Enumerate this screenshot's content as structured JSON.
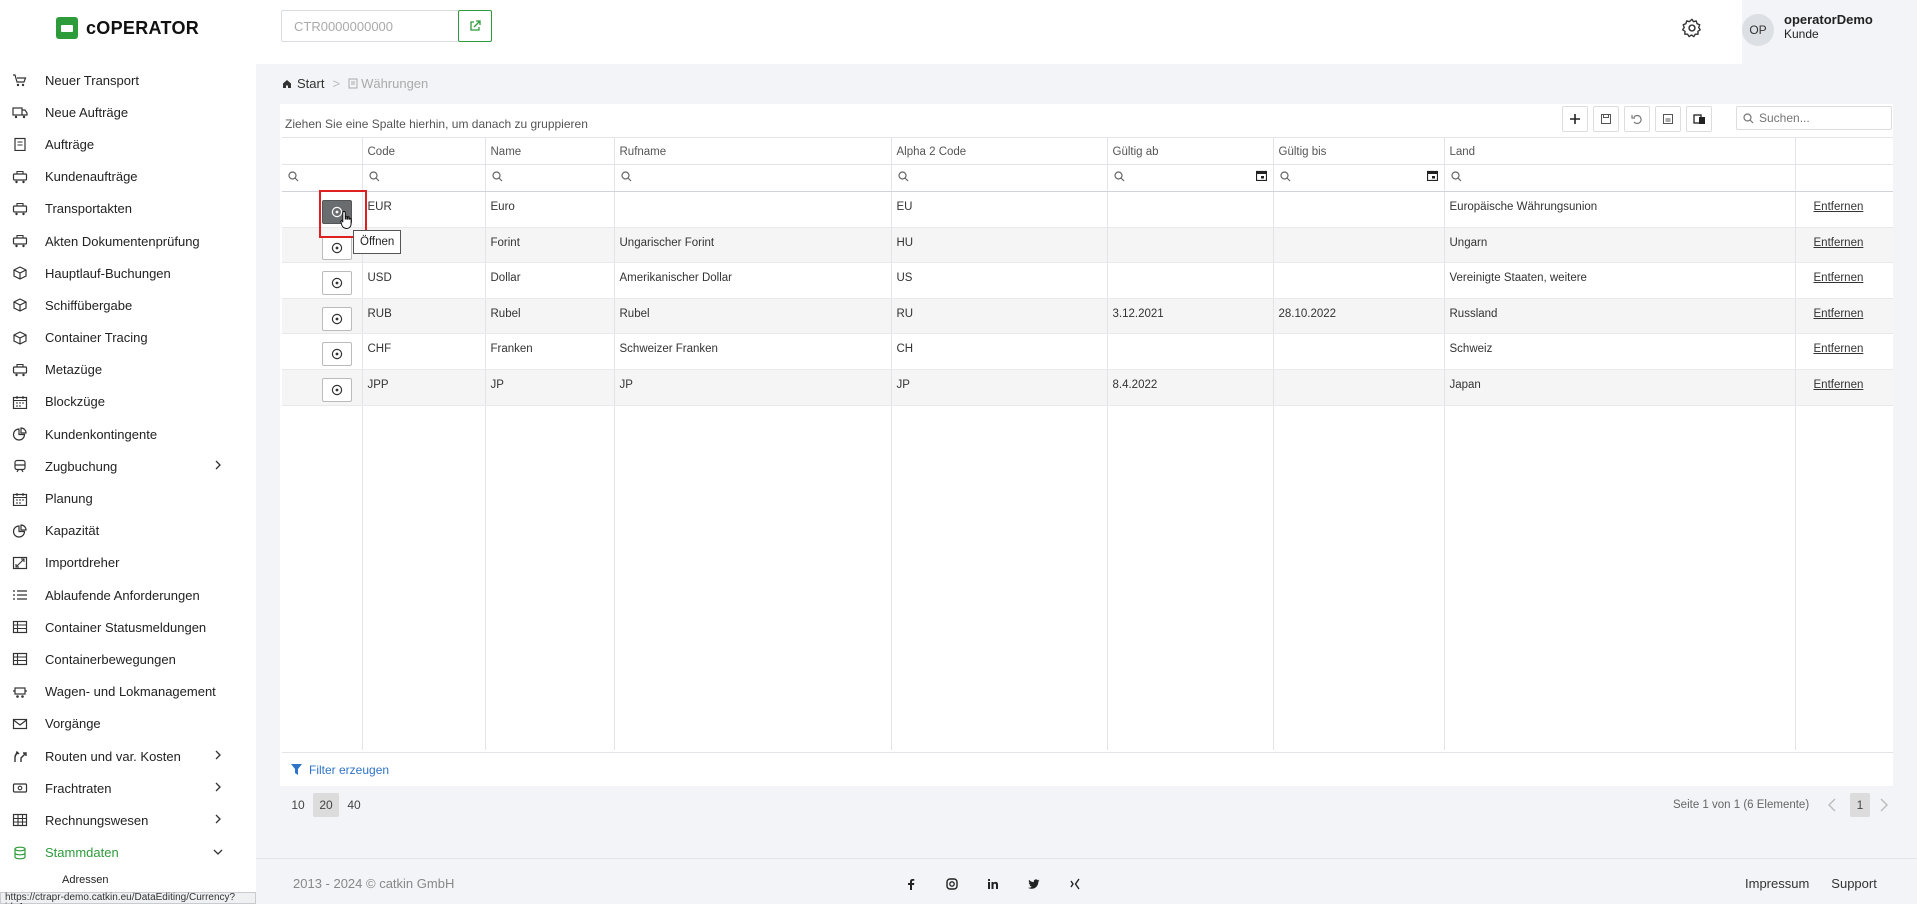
{
  "app": {
    "name": "cOPERATOR"
  },
  "sidebar": {
    "items": [
      {
        "label": "Neuer Transport",
        "icon": "truck-cart-icon"
      },
      {
        "label": "Neue Aufträge",
        "icon": "truck-plus-icon"
      },
      {
        "label": "Aufträge",
        "icon": "clipboard-icon"
      },
      {
        "label": "Kundenaufträge",
        "icon": "train-icon"
      },
      {
        "label": "Transportakten",
        "icon": "train-icon"
      },
      {
        "label": "Akten Dokumentenprüfung",
        "icon": "train-icon"
      },
      {
        "label": "Hauptlauf-Buchungen",
        "icon": "cube-icon"
      },
      {
        "label": "Schiffübergabe",
        "icon": "cube-icon"
      },
      {
        "label": "Container Tracing",
        "icon": "cube-icon"
      },
      {
        "label": "Metazüge",
        "icon": "train-icon"
      },
      {
        "label": "Blockzüge",
        "icon": "calendar-icon"
      },
      {
        "label": "Kundenkontingente",
        "icon": "pie-chart-icon"
      },
      {
        "label": "Zugbuchung",
        "icon": "train-front-icon",
        "expandable": true
      },
      {
        "label": "Planung",
        "icon": "calendar-icon"
      },
      {
        "label": "Kapazität",
        "icon": "pie-chart-icon"
      },
      {
        "label": "Importdreher",
        "icon": "swap-icon"
      },
      {
        "label": "Ablaufende Anforderungen",
        "icon": "list-icon"
      },
      {
        "label": "Container Statusmeldungen",
        "icon": "table-icon"
      },
      {
        "label": "Containerbewegungen",
        "icon": "table-icon"
      },
      {
        "label": "Wagen- und Lokmanagement",
        "icon": "wagon-icon"
      },
      {
        "label": "Vorgänge",
        "icon": "mail-icon"
      },
      {
        "label": "Routen und var. Kosten",
        "icon": "route-icon",
        "expandable": true
      },
      {
        "label": "Frachtraten",
        "icon": "money-icon",
        "expandable": true
      },
      {
        "label": "Rechnungswesen",
        "icon": "grid-icon",
        "expandable": true
      },
      {
        "label": "Stammdaten",
        "icon": "database-icon",
        "expandable": true,
        "active": true
      }
    ],
    "sub_items": [
      {
        "label": "Adressen"
      }
    ],
    "status_url": "https://ctrapr-demo.catkin.eu/DataEditing/Currency?id=1"
  },
  "topbar": {
    "ctr_placeholder": "CTR0000000000",
    "user": {
      "initials": "OP",
      "name": "operatorDemo",
      "role": "Kunde"
    }
  },
  "breadcrumb": {
    "home": "Start",
    "separator": ">",
    "current": "Währungen"
  },
  "grid": {
    "group_hint": "Ziehen Sie eine Spalte hierhin, um danach zu gruppieren",
    "search_placeholder": "Suchen...",
    "columns": [
      "Code",
      "Name",
      "Rufname",
      "Alpha 2 Code",
      "Gültig ab",
      "Gültig bis",
      "Land"
    ],
    "rows": [
      {
        "code": "EUR",
        "name": "Euro",
        "rufname": "",
        "alpha2": "EU",
        "from": "",
        "to": "",
        "land": "Europäische Währungsunion",
        "action": "Entfernen"
      },
      {
        "code": "",
        "name": "Forint",
        "rufname": "Ungarischer Forint",
        "alpha2": "HU",
        "from": "",
        "to": "",
        "land": "Ungarn",
        "action": "Entfernen"
      },
      {
        "code": "USD",
        "name": "Dollar",
        "rufname": "Amerikanischer Dollar",
        "alpha2": "US",
        "from": "",
        "to": "",
        "land": "Vereinigte Staaten, weitere",
        "action": "Entfernen"
      },
      {
        "code": "RUB",
        "name": "Rubel",
        "rufname": "Rubel",
        "alpha2": "RU",
        "from": "3.12.2021",
        "to": "28.10.2022",
        "land": "Russland",
        "action": "Entfernen"
      },
      {
        "code": "CHF",
        "name": "Franken",
        "rufname": "Schweizer Franken",
        "alpha2": "CH",
        "from": "",
        "to": "",
        "land": "Schweiz",
        "action": "Entfernen"
      },
      {
        "code": "JPP",
        "name": "JP",
        "rufname": "JP",
        "alpha2": "JP",
        "from": "8.4.2022",
        "to": "",
        "land": "Japan",
        "action": "Entfernen"
      }
    ],
    "tooltip": "Öffnen",
    "filter_label": "Filter erzeugen"
  },
  "pager": {
    "sizes": [
      "10",
      "20",
      "40"
    ],
    "selected_size": "20",
    "info": "Seite 1 von 1 (6 Elemente)",
    "current_page": "1"
  },
  "footer": {
    "copyright": "2013 - 2024 © catkin GmbH",
    "social": [
      "facebook-icon",
      "instagram-icon",
      "linkedin-icon",
      "twitter-icon",
      "xing-icon"
    ],
    "links": [
      "Impressum",
      "Support"
    ]
  },
  "colors": {
    "brand": "#2e9b3a",
    "link_blue": "#2f73c8",
    "highlight_red": "#e02020"
  }
}
